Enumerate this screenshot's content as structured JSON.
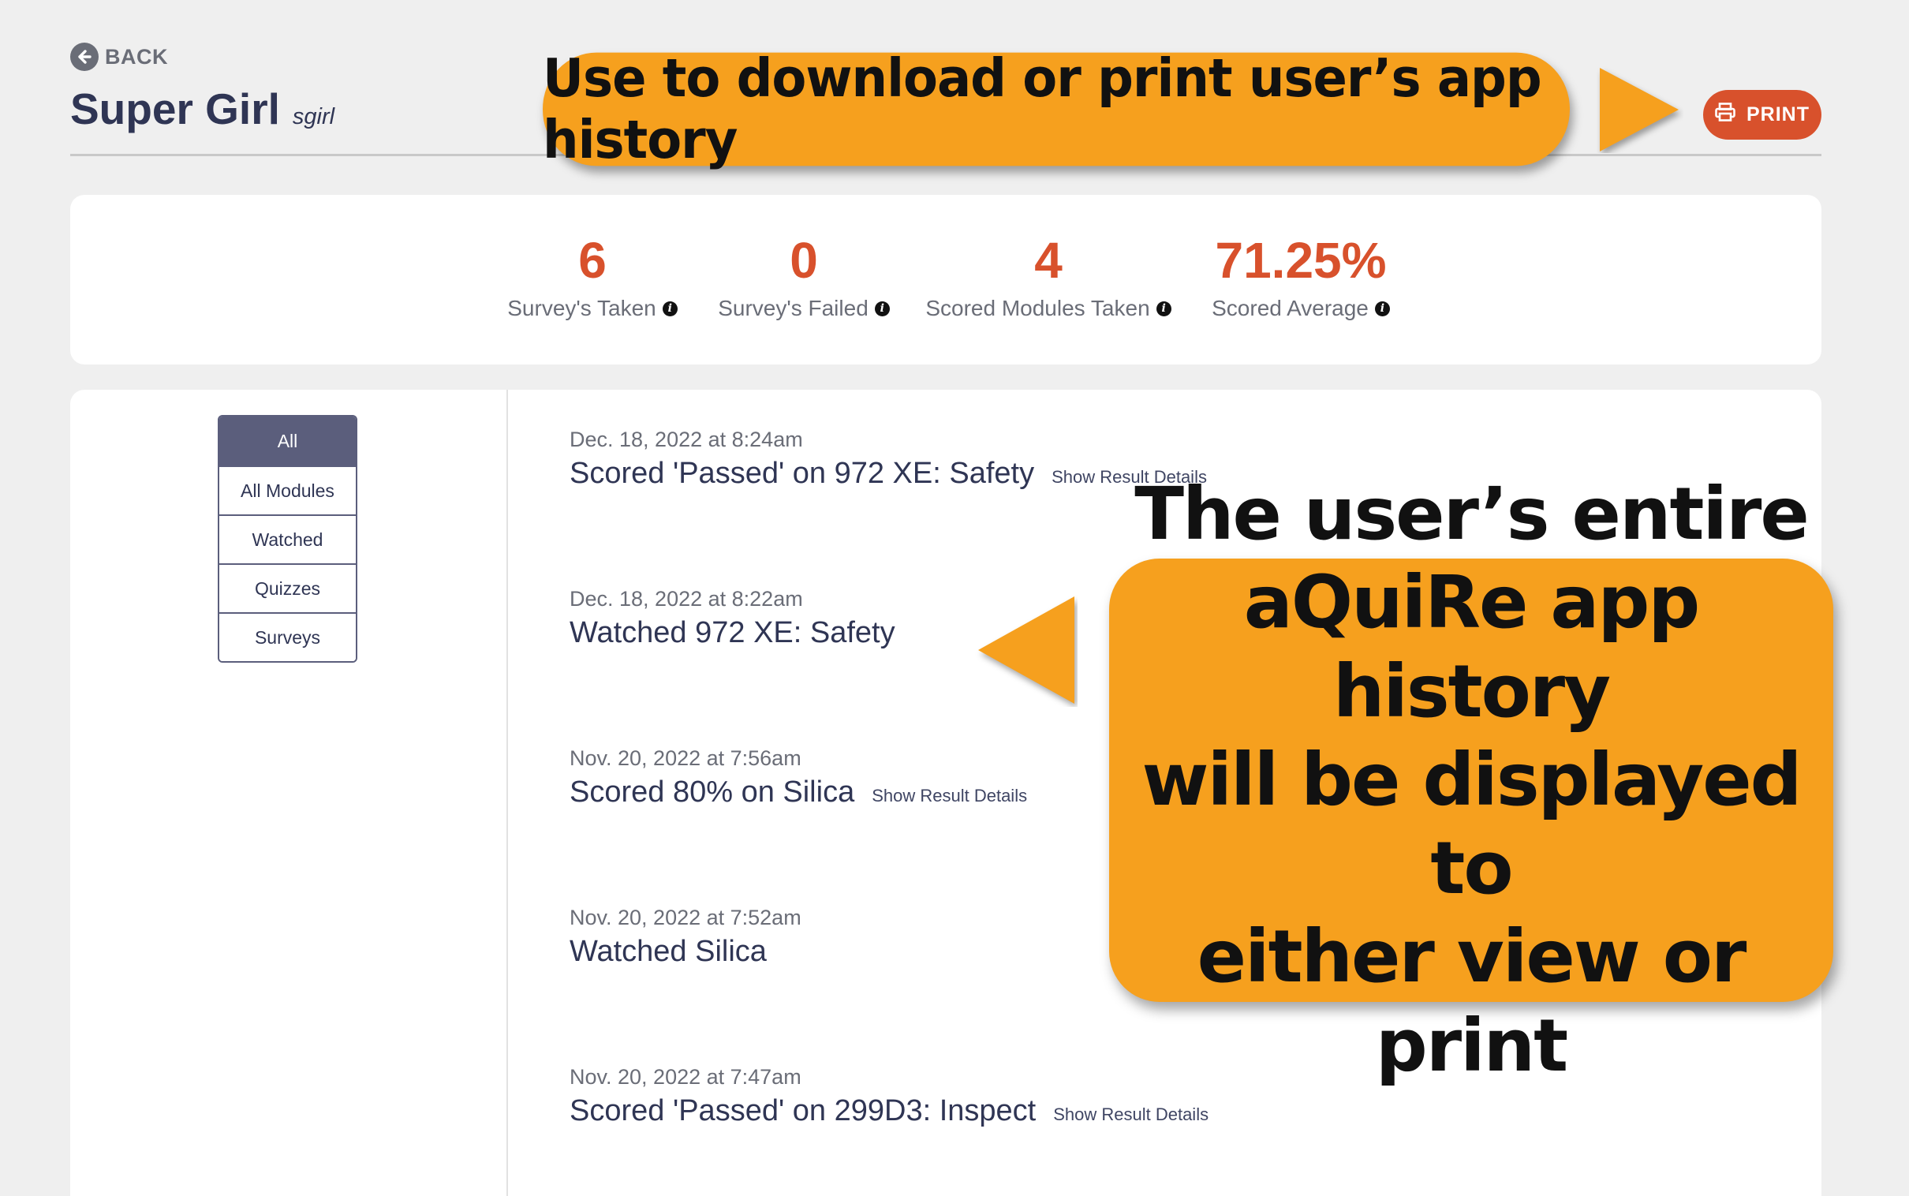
{
  "header": {
    "back_label": "BACK",
    "user_name": "Super Girl",
    "user_handle": "sgirl",
    "print_label": "PRINT"
  },
  "stats": [
    {
      "value": "6",
      "label": "Survey's Taken"
    },
    {
      "value": "0",
      "label": "Survey's Failed"
    },
    {
      "value": "4",
      "label": "Scored Modules Taken"
    },
    {
      "value": "71.25%",
      "label": "Scored Average"
    }
  ],
  "filters": [
    {
      "label": "All",
      "active": true
    },
    {
      "label": "All Modules",
      "active": false
    },
    {
      "label": "Watched",
      "active": false
    },
    {
      "label": "Quizzes",
      "active": false
    },
    {
      "label": "Surveys",
      "active": false
    }
  ],
  "history": [
    {
      "date": "Dec. 18, 2022 at 8:24am",
      "description": "Scored 'Passed' on 972 XE: Safety",
      "details_link": "Show Result Details"
    },
    {
      "date": "Dec. 18, 2022 at 8:22am",
      "description": "Watched 972 XE: Safety",
      "details_link": ""
    },
    {
      "date": "Nov. 20, 2022 at 7:56am",
      "description": "Scored 80% on Silica",
      "details_link": "Show Result Details"
    },
    {
      "date": "Nov. 20, 2022 at 7:52am",
      "description": "Watched Silica",
      "details_link": ""
    },
    {
      "date": "Nov. 20, 2022 at 7:47am",
      "description": "Scored 'Passed' on 299D3: Inspect",
      "details_link": "Show Result Details"
    }
  ],
  "callouts": {
    "print_hint": "Use to download or print user’s app history",
    "history_hint_lines": [
      "The user’s entire",
      "aQuiRe app history",
      "will be displayed to",
      "either view or print"
    ]
  },
  "colors": {
    "accent": "#d8512c",
    "navy": "#2f3554",
    "filter_active": "#5b5e7c",
    "callout": "#f6a01e",
    "background": "#efefef"
  },
  "icons": {
    "back": "arrow-left-circle-icon",
    "print": "printer-icon",
    "info": "info-icon"
  }
}
